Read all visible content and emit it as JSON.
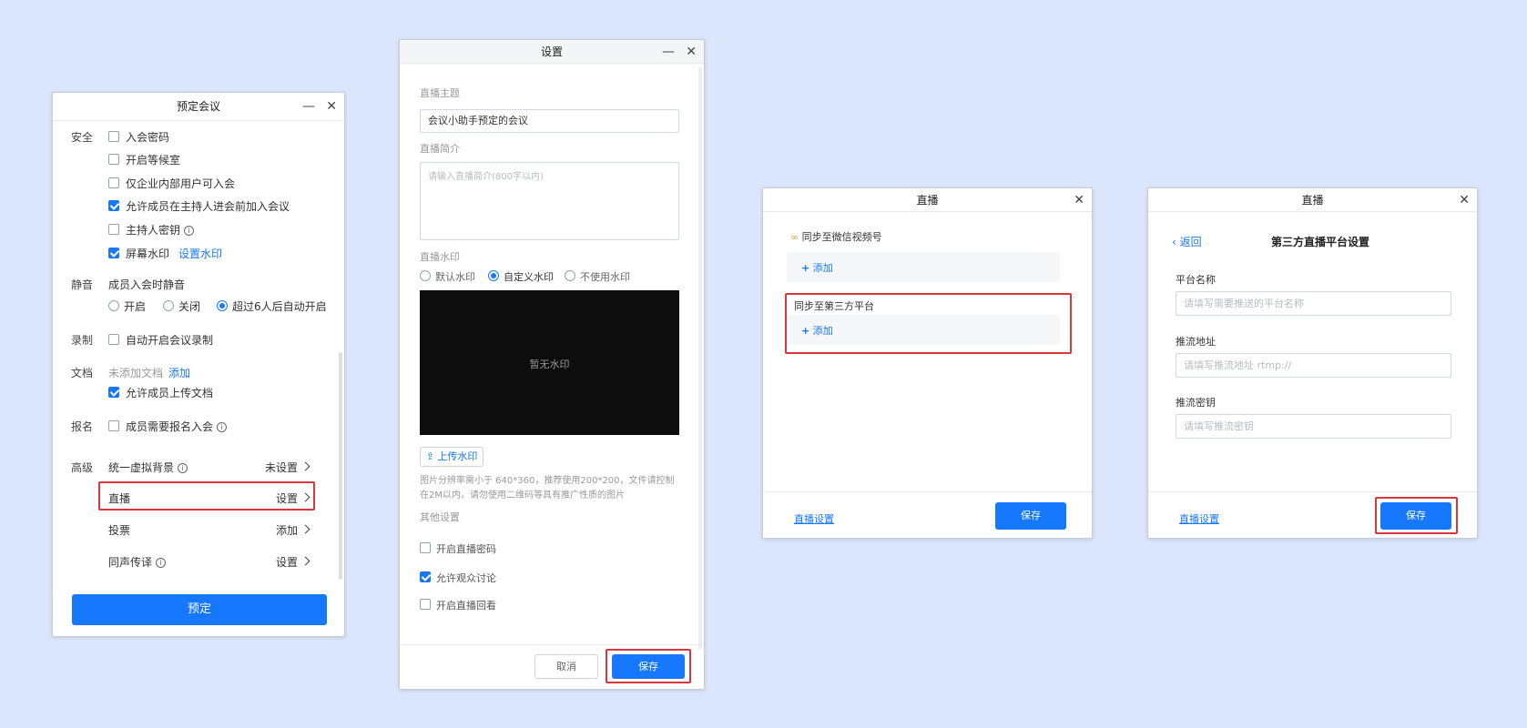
{
  "win1": {
    "title": "预定会议",
    "sections": {
      "security": "安全",
      "mute": "静音",
      "record": "录制",
      "docs": "文档",
      "signup": "报名",
      "advanced": "高级"
    },
    "security": {
      "password": "入会密码",
      "waiting_room": "开启等候室",
      "internal_only": "仅企业内部用户可入会",
      "join_before_host": "允许成员在主持人进会前加入会议",
      "host_key": "主持人密钥",
      "watermark": "屏幕水印",
      "watermark_settings": "设置水印"
    },
    "mute": {
      "label": "成员入会时静音",
      "opt_on": "开启",
      "opt_off": "关闭",
      "opt_auto": "超过6人后自动开启"
    },
    "record": {
      "auto": "自动开启会议录制"
    },
    "docs": {
      "none": "未添加文档",
      "add": "添加",
      "allow_upload": "允许成员上传文档"
    },
    "signup": {
      "require": "成员需要报名入会"
    },
    "advanced": {
      "bg": "统一虚拟背景",
      "bg_value": "未设置",
      "live": "直播",
      "live_value": "设置",
      "vote": "投票",
      "vote_value": "添加",
      "interp": "同声传译",
      "interp_value": "设置"
    },
    "submit": "预定"
  },
  "win2": {
    "title": "设置",
    "topic_label": "直播主题",
    "topic_value": "会议小助手预定的会议",
    "intro_label": "直播简介",
    "intro_placeholder": "请输入直播简介(800字以内)",
    "wm_label": "直播水印",
    "wm_default": "默认水印",
    "wm_custom": "自定义水印",
    "wm_none": "不使用水印",
    "preview_text": "暂无水印",
    "upload": "上传水印",
    "hint": "图片分辨率需小于 640*360，推荐使用200*200，文件请控制在2M以内。请勿使用二维码等具有推广性质的图片",
    "other_label": "其他设置",
    "opt_password": "开启直播密码",
    "opt_discuss": "允许观众讨论",
    "opt_replay": "开启直播回看",
    "cancel": "取消",
    "save": "保存"
  },
  "win3": {
    "title": "直播",
    "wechat_label": "同步至微信视频号",
    "add1": "添加",
    "third_label": "同步至第三方平台",
    "add2": "添加",
    "settings_link": "直播设置",
    "save": "保存"
  },
  "win4": {
    "title": "直播",
    "back": "返回",
    "heading": "第三方直播平台设置",
    "name_label": "平台名称",
    "name_placeholder": "请填写需要推送的平台名称",
    "url_label": "推流地址",
    "url_placeholder": "请填写推流地址 rtmp://",
    "key_label": "推流密钥",
    "key_placeholder": "请填写推流密钥",
    "settings_link": "直播设置",
    "save": "保存"
  },
  "colors": {
    "accent": "#1677ff",
    "highlight": "#d9363e",
    "background": "#dbe5fb"
  }
}
